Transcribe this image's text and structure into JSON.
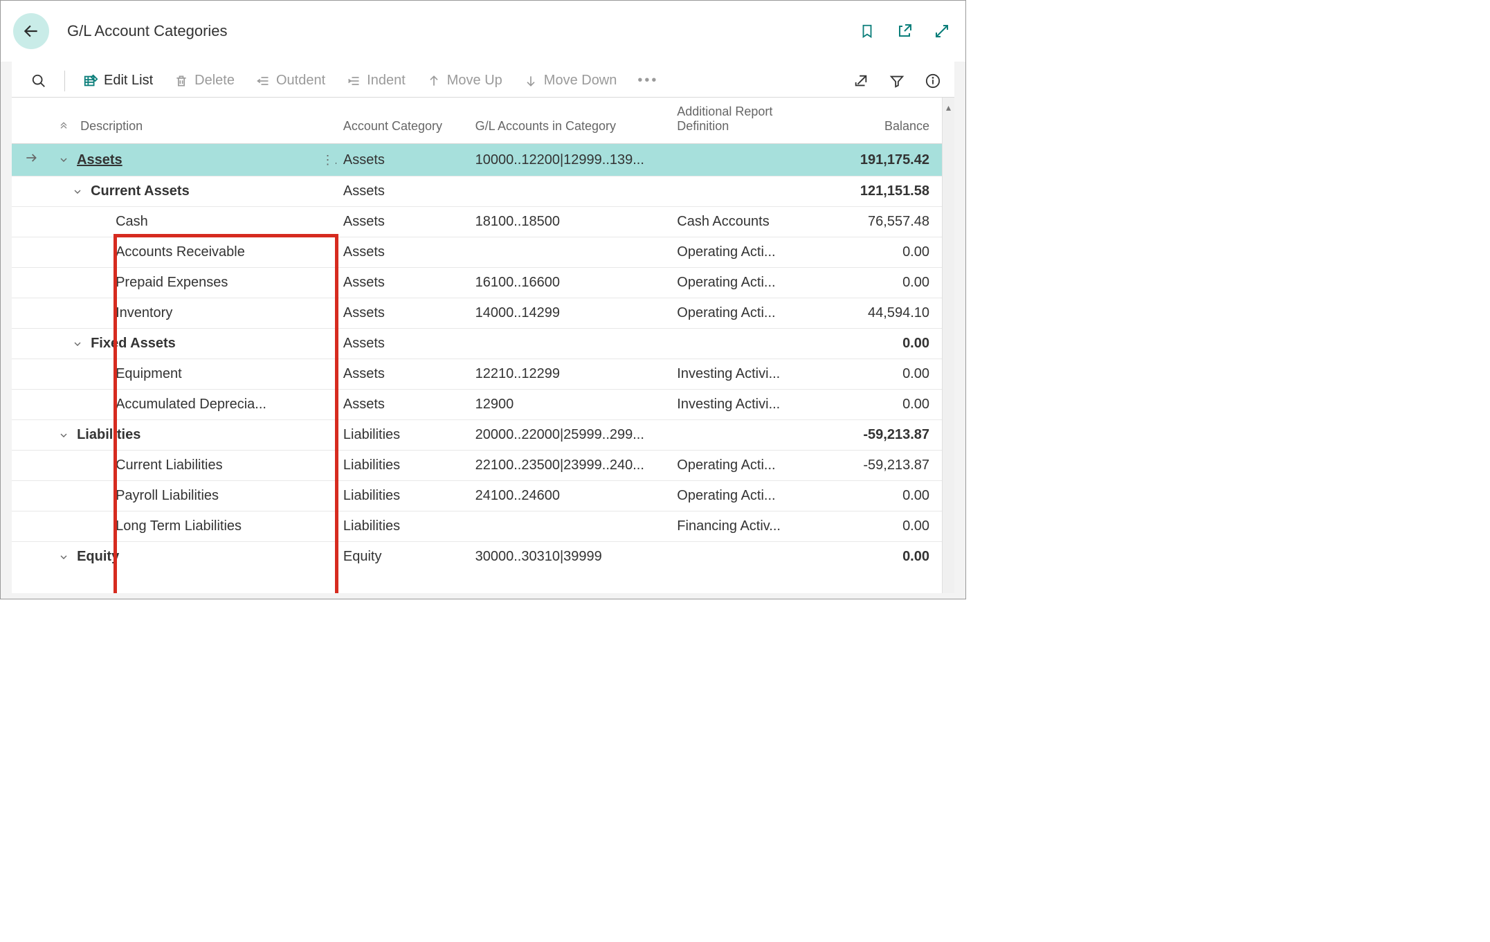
{
  "header": {
    "title": "G/L Account Categories"
  },
  "toolbar": {
    "edit_list": "Edit List",
    "delete": "Delete",
    "outdent": "Outdent",
    "indent": "Indent",
    "move_up": "Move Up",
    "move_down": "Move Down"
  },
  "columns": {
    "description": "Description",
    "account_category": "Account Category",
    "gl_accounts": "G/L Accounts in Category",
    "report_def": "Additional Report Definition",
    "balance": "Balance"
  },
  "rows": [
    {
      "selected": true,
      "indent": 0,
      "expandable": true,
      "bold": true,
      "description": "Assets",
      "category": "Assets",
      "gl": "10000..12200|12999..139...",
      "report": "",
      "balance": "191,175.42"
    },
    {
      "selected": false,
      "indent": 1,
      "expandable": true,
      "bold": true,
      "description": "Current Assets",
      "category": "Assets",
      "gl": "",
      "report": "",
      "balance": "121,151.58"
    },
    {
      "selected": false,
      "indent": 2,
      "expandable": false,
      "bold": false,
      "description": "Cash",
      "category": "Assets",
      "gl": "18100..18500",
      "report": "Cash Accounts",
      "balance": "76,557.48"
    },
    {
      "selected": false,
      "indent": 2,
      "expandable": false,
      "bold": false,
      "description": "Accounts Receivable",
      "category": "Assets",
      "gl": "",
      "report": "Operating Acti...",
      "balance": "0.00"
    },
    {
      "selected": false,
      "indent": 2,
      "expandable": false,
      "bold": false,
      "description": "Prepaid Expenses",
      "category": "Assets",
      "gl": "16100..16600",
      "report": "Operating Acti...",
      "balance": "0.00"
    },
    {
      "selected": false,
      "indent": 2,
      "expandable": false,
      "bold": false,
      "description": "Inventory",
      "category": "Assets",
      "gl": "14000..14299",
      "report": "Operating Acti...",
      "balance": "44,594.10"
    },
    {
      "selected": false,
      "indent": 1,
      "expandable": true,
      "bold": true,
      "description": "Fixed Assets",
      "category": "Assets",
      "gl": "",
      "report": "",
      "balance": "0.00"
    },
    {
      "selected": false,
      "indent": 2,
      "expandable": false,
      "bold": false,
      "description": "Equipment",
      "category": "Assets",
      "gl": "12210..12299",
      "report": "Investing Activi...",
      "balance": "0.00"
    },
    {
      "selected": false,
      "indent": 2,
      "expandable": false,
      "bold": false,
      "description": "Accumulated Deprecia...",
      "category": "Assets",
      "gl": "12900",
      "report": "Investing Activi...",
      "balance": "0.00"
    },
    {
      "selected": false,
      "indent": 0,
      "expandable": true,
      "bold": true,
      "description": "Liabilities",
      "category": "Liabilities",
      "gl": "20000..22000|25999..299...",
      "report": "",
      "balance": "-59,213.87"
    },
    {
      "selected": false,
      "indent": 2,
      "expandable": false,
      "bold": false,
      "description": "Current Liabilities",
      "category": "Liabilities",
      "gl": "22100..23500|23999..240...",
      "report": "Operating Acti...",
      "balance": "-59,213.87"
    },
    {
      "selected": false,
      "indent": 2,
      "expandable": false,
      "bold": false,
      "description": "Payroll Liabilities",
      "category": "Liabilities",
      "gl": "24100..24600",
      "report": "Operating Acti...",
      "balance": "0.00"
    },
    {
      "selected": false,
      "indent": 2,
      "expandable": false,
      "bold": false,
      "description": "Long Term Liabilities",
      "category": "Liabilities",
      "gl": "",
      "report": "Financing Activ...",
      "balance": "0.00"
    },
    {
      "selected": false,
      "indent": 0,
      "expandable": true,
      "bold": true,
      "description": "Equity",
      "category": "Equity",
      "gl": "30000..30310|39999",
      "report": "",
      "balance": "0.00"
    }
  ]
}
